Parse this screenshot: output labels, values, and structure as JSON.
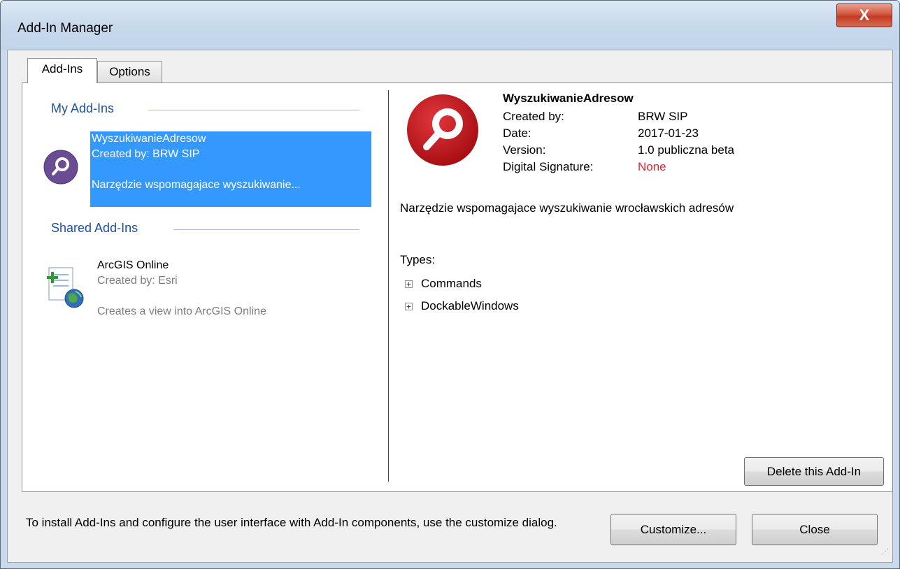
{
  "window": {
    "title": "Add-In Manager",
    "close_glyph": "X"
  },
  "tabs": [
    {
      "label": "Add-Ins",
      "active": true
    },
    {
      "label": "Options",
      "active": false
    }
  ],
  "my_addins": {
    "header": "My Add-Ins",
    "items": [
      {
        "name": "WyszukiwanieAdresow",
        "created_by": "Created by: BRW SIP",
        "description": "Narzędzie wspomagajace wyszukiwanie...",
        "icon": "magnifier-icon",
        "selected": true
      }
    ]
  },
  "shared_addins": {
    "header": "Shared Add-Ins",
    "items": [
      {
        "name": "ArcGIS Online",
        "created_by": "Created by: Esri",
        "description": "Creates a view into ArcGIS Online",
        "icon": "arcgis-online-icon"
      }
    ]
  },
  "details": {
    "title": "WyszukiwanieAdresow",
    "fields": [
      {
        "label": "Created by:",
        "value": "BRW SIP"
      },
      {
        "label": "Date:",
        "value": "2017-01-23"
      },
      {
        "label": "Version:",
        "value": "1.0 publiczna beta"
      },
      {
        "label": "Digital Signature:",
        "value": "None"
      }
    ],
    "description": "Narzędzie wspomagajace wyszukiwanie wrocławskich adresów",
    "types_label": "Types:",
    "types": [
      {
        "label": "Commands",
        "expander": "+"
      },
      {
        "label": "DockableWindows",
        "expander": "+"
      }
    ],
    "delete_button": "Delete this Add-In"
  },
  "footer": {
    "hint": "To install Add-Ins and configure the user interface with Add-In components, use the customize dialog.",
    "customize_button": "Customize...",
    "close_button": "Close"
  },
  "colors": {
    "selection": "#3399ff",
    "group_header": "#1e50a0",
    "signature_none": "#e8252f",
    "big_icon_red": "#c4161c",
    "small_icon_purple": "#6a4c93"
  }
}
